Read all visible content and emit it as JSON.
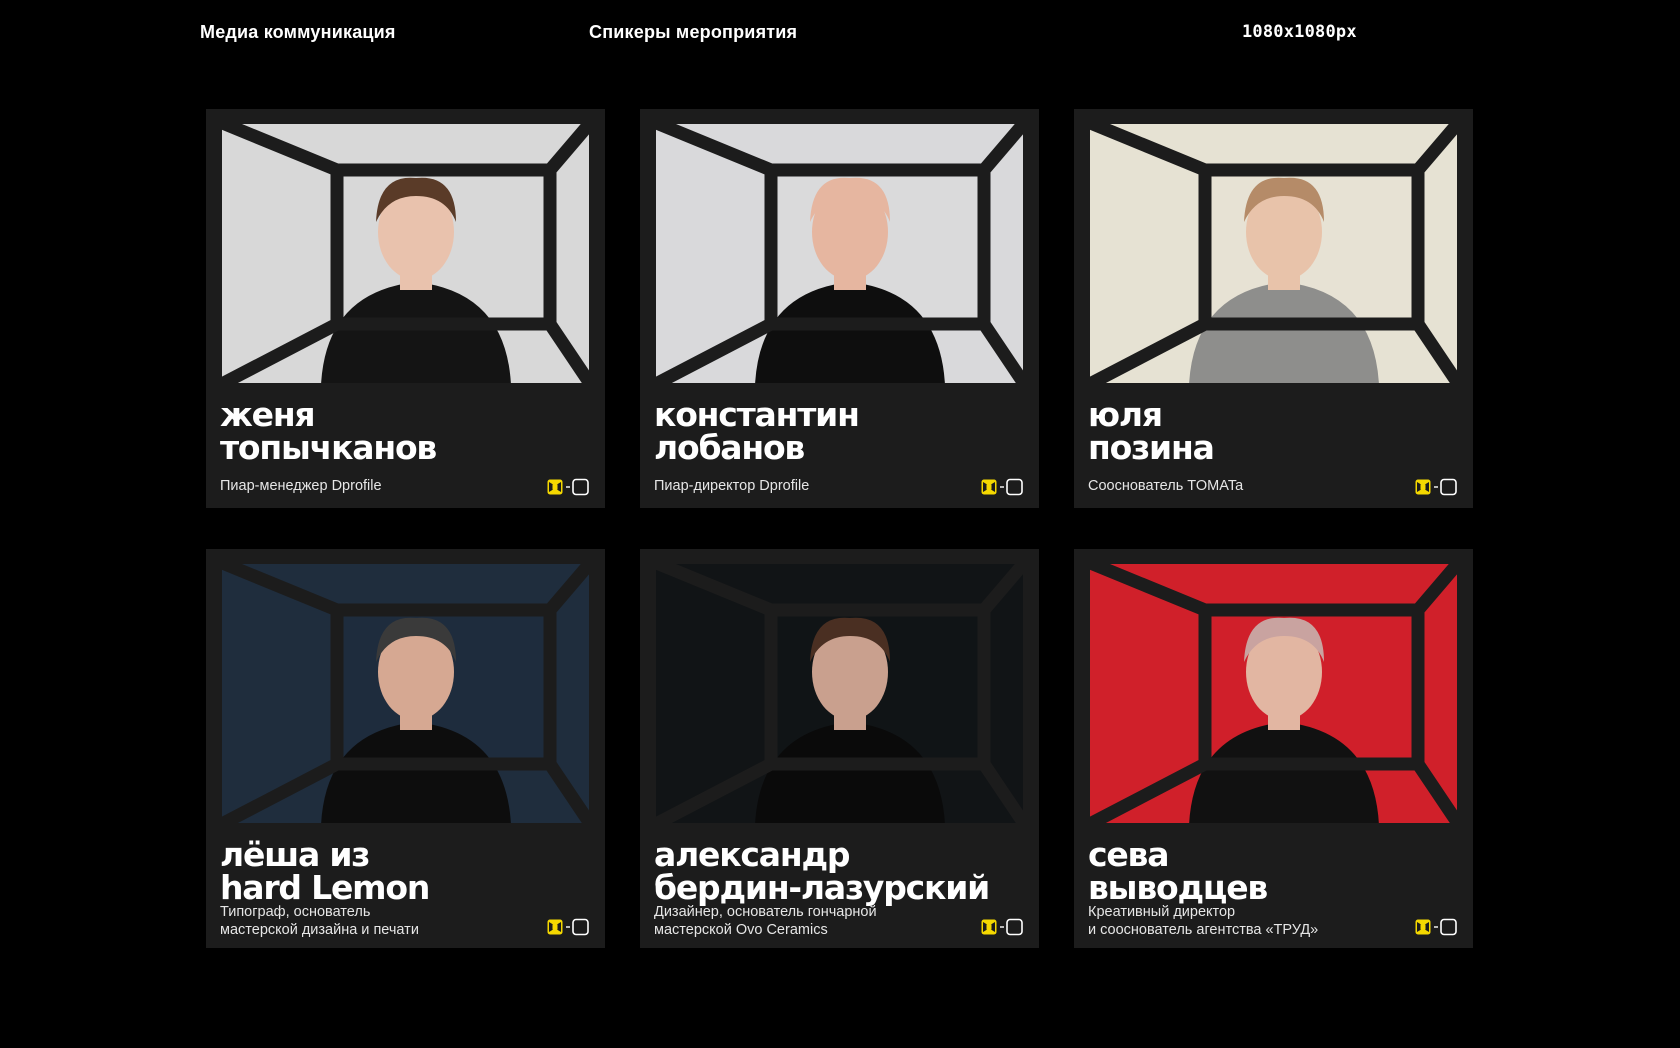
{
  "header": {
    "left": "Медиа коммуникация",
    "center": "Спикеры мероприятия",
    "right": "1080x1080px"
  },
  "colors": {
    "accent": "#f5d800",
    "card_bg": "#1c1c1c",
    "frame": "#1c1c1c",
    "page_bg": "#000000"
  },
  "cards": [
    {
      "name_line1": "женя",
      "name_line2": "топычканов",
      "role_line1": "Пиар-менеджер Dprofile",
      "role_line2": "",
      "photo_bg": "#d8d8d8",
      "clothing": "#141414",
      "hair": "#5a3b28",
      "skin": "#e9c2ad"
    },
    {
      "name_line1": "константин",
      "name_line2": "лобанов",
      "role_line1": "Пиар-директор Dprofile",
      "role_line2": "",
      "photo_bg": "#d9d9db",
      "clothing": "#0e0e0e",
      "hair": "#e6b6a0",
      "skin": "#e6b6a0"
    },
    {
      "name_line1": "юля",
      "name_line2": "позина",
      "role_line1": "Сооснователь TOMATa",
      "role_line2": "",
      "photo_bg": "#e6e2d3",
      "clothing": "#8e8e8c",
      "hair": "#b58b68",
      "skin": "#e8c3aa"
    },
    {
      "name_line1": "лёша из",
      "name_line2": "hard Lemon",
      "role_line1": "Типограф, основатель",
      "role_line2": "мастерской дизайна и печати",
      "photo_bg": "#1f2d3d",
      "clothing": "#0d0d0d",
      "hair": "#3a3a3a",
      "skin": "#d6a892"
    },
    {
      "name_line1": "александр",
      "name_line2": "бердин-лазурский",
      "role_line1": "Дизайнер, основатель гончарной",
      "role_line2": "мастерской Ovo Ceramics",
      "photo_bg": "#111416",
      "clothing": "#0a0a0a",
      "hair": "#4a2f22",
      "skin": "#c9a08e"
    },
    {
      "name_line1": "сева",
      "name_line2": "выводцев",
      "role_line1": "Креативный директор",
      "role_line2": "и сооснователь агентства «ТРУД»",
      "photo_bg": "#d0202a",
      "clothing": "#111111",
      "hair": "#c9a3a0",
      "skin": "#e2b6a2"
    }
  ]
}
